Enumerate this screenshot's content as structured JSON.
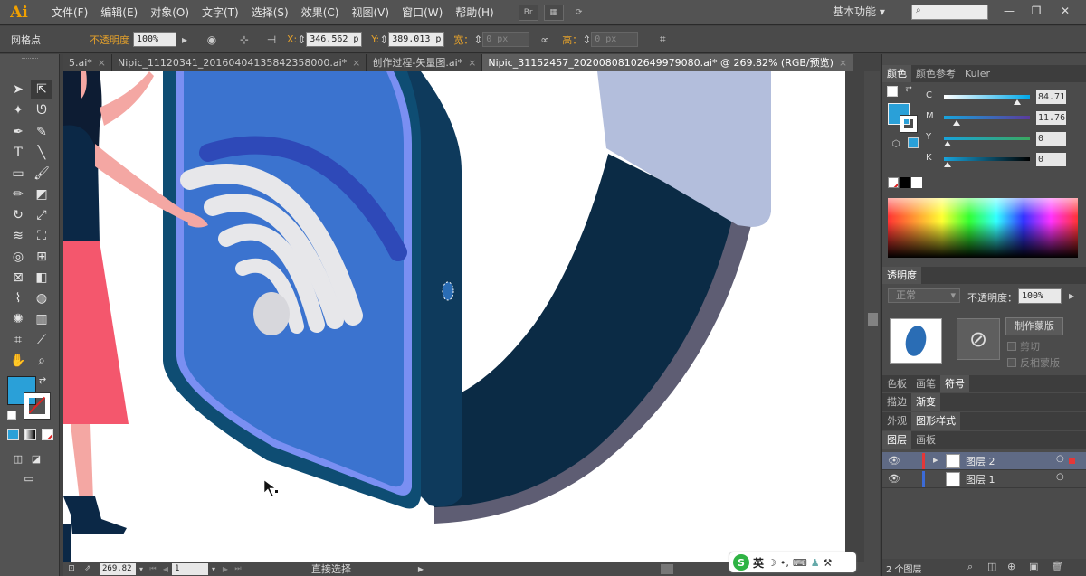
{
  "app": {
    "logo": "Ai"
  },
  "menubar": {
    "items": [
      "文件(F)",
      "编辑(E)",
      "对象(O)",
      "文字(T)",
      "选择(S)",
      "效果(C)",
      "视图(V)",
      "窗口(W)",
      "帮助(H)"
    ],
    "br_label": "Br",
    "workspace": "基本功能",
    "search_placeholder": ""
  },
  "control_bar": {
    "selection_label": "网格点",
    "opacity_label": "不透明度",
    "opacity_value": "100%",
    "x_label": "X:",
    "x_value": "346.562 p",
    "y_label": "Y:",
    "y_value": "389.013 p",
    "w_label": "宽：",
    "w_value": "0 px",
    "h_label": "高：",
    "h_value": "0 px"
  },
  "tabs": [
    {
      "label": "5.ai*",
      "active": false
    },
    {
      "label": "Nipic_11120341_20160404135842358000.ai*",
      "active": false
    },
    {
      "label": "创作过程-矢量图.ai*",
      "active": false
    },
    {
      "label": "Nipic_31152457_20200808102649979080.ai* @ 269.82% (RGB/预览)",
      "active": true
    }
  ],
  "status_bar": {
    "zoom": "269.82",
    "page": "1",
    "tool_name": "直接选择"
  },
  "color_panel": {
    "tabs": [
      "颜色",
      "颜色参考",
      "Kuler"
    ],
    "sliders": [
      {
        "letter": "C",
        "value": "84.71"
      },
      {
        "letter": "M",
        "value": "11.76"
      },
      {
        "letter": "Y",
        "value": "0"
      },
      {
        "letter": "K",
        "value": "0"
      }
    ],
    "fill_color": "#2aa0d8"
  },
  "transparency_panel": {
    "title": "透明度",
    "blend_mode": "正常",
    "opacity_label": "不透明度：",
    "opacity_value": "100%",
    "make_mask": "制作蒙版",
    "clip": "剪切",
    "invert_mask": "反相蒙版"
  },
  "mid_tabs": {
    "row1": [
      "色板",
      "画笔",
      "符号"
    ],
    "row2": [
      "描边",
      "渐变"
    ],
    "row3": [
      "外观",
      "图形样式"
    ]
  },
  "layers_panel": {
    "tabs": [
      "图层",
      "画板"
    ],
    "layers": [
      {
        "name": "图层 2",
        "selected": true,
        "color": "#e43838"
      },
      {
        "name": "图层 1",
        "selected": false,
        "color": "#3c6bd6"
      }
    ],
    "count": "2 个图层"
  },
  "ime": {
    "lang": "英"
  }
}
